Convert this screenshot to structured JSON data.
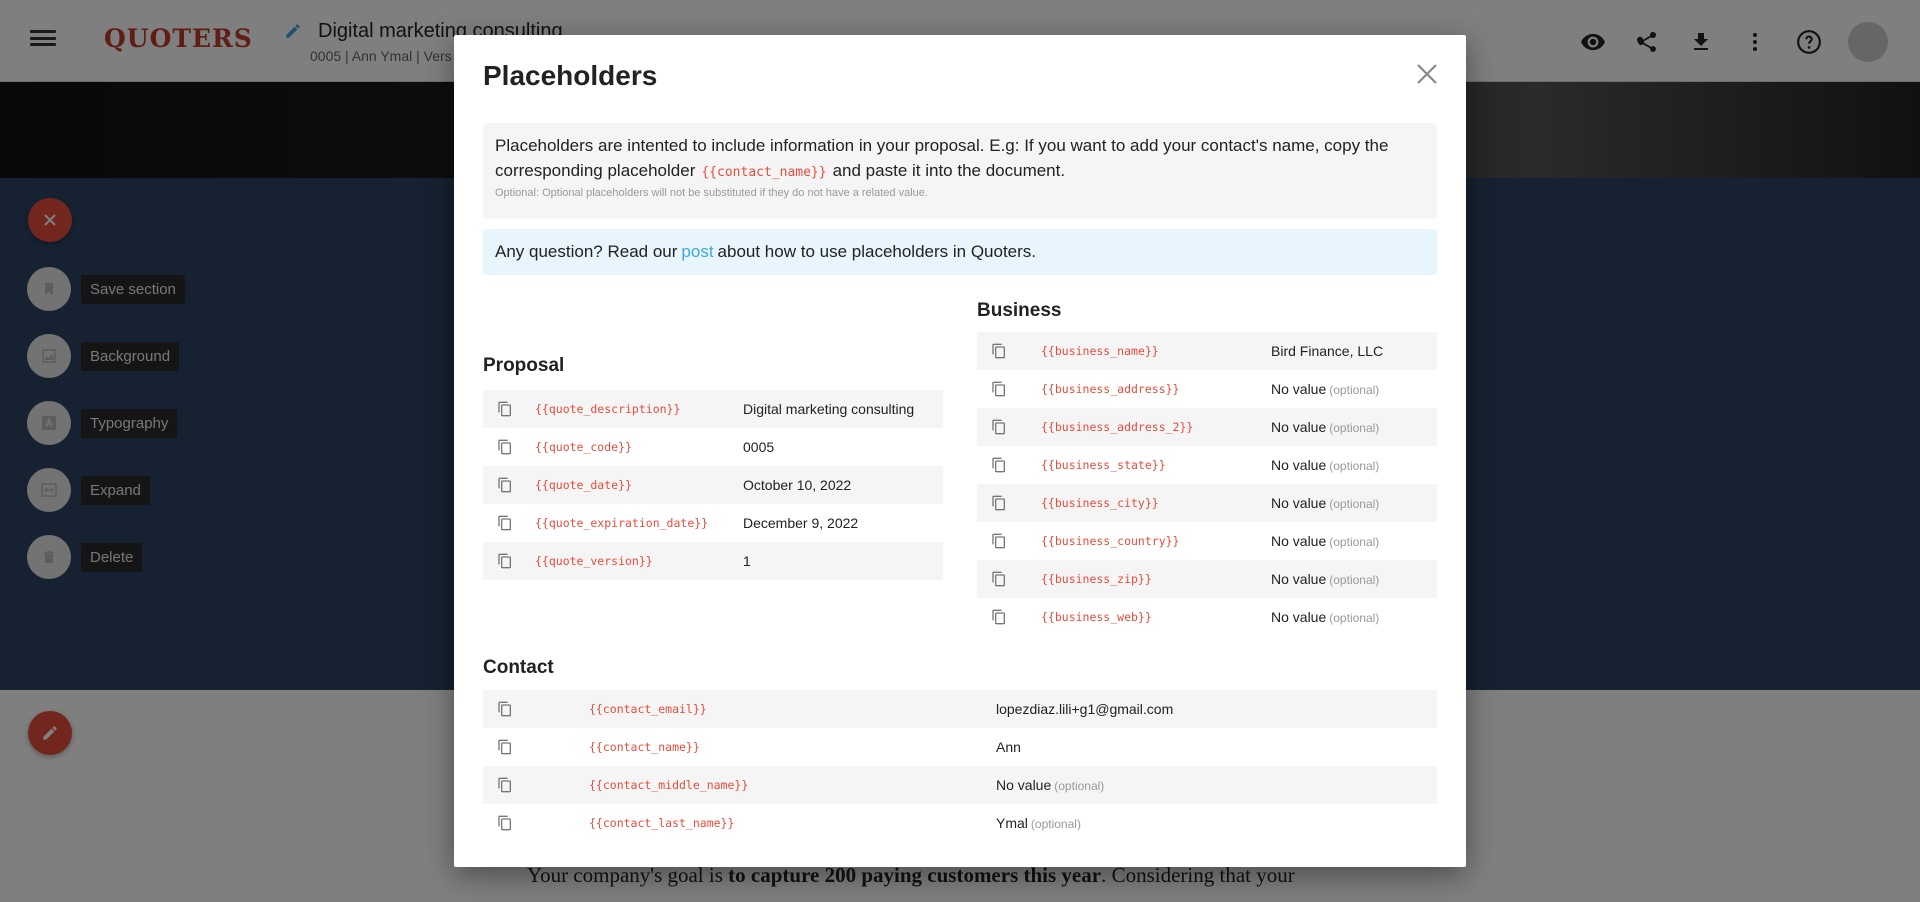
{
  "app": {
    "logo": "QUOTERS",
    "doc_title": "Digital marketing consulting",
    "doc_subtitle": "0005 | Ann Ymal | Vers"
  },
  "toolbar": {
    "icons": [
      "eye-icon",
      "share-icon",
      "download-icon",
      "more-vert-icon",
      "help-icon",
      "user-avatar"
    ]
  },
  "side_tools": [
    {
      "label": "Save section",
      "icon": "bookmark-icon"
    },
    {
      "label": "Background",
      "icon": "image-icon"
    },
    {
      "label": "Typography",
      "icon": "font-icon"
    },
    {
      "label": "Expand",
      "icon": "expand-icon"
    },
    {
      "label": "Delete",
      "icon": "trash-icon"
    }
  ],
  "body_text": {
    "before": "Your company's goal is ",
    "bold": "to capture 200 paying customers this year",
    "after": ". Considering that your"
  },
  "modal": {
    "title": "Placeholders",
    "info_text_1": "Placeholders are intented to include information in your proposal. E.g: If you want to add your contact's name, copy the corresponding placeholder",
    "info_code": "{{contact_name}}",
    "info_text_2": "and paste it into the document.",
    "info_optional": "Optional: Optional placeholders will not be substituted if they do not have a related value.",
    "question_before": "Any question? Read our",
    "question_link": "post",
    "question_after": "about how to use placeholders in Quoters.",
    "no_value": "No value",
    "optional_tag": "(optional)",
    "proposal": {
      "heading": "Proposal",
      "rows": [
        {
          "code": "{{quote_description}}",
          "value": "Digital marketing consulting",
          "optional": false
        },
        {
          "code": "{{quote_code}}",
          "value": "0005",
          "optional": false
        },
        {
          "code": "{{quote_date}}",
          "value": "October 10, 2022",
          "optional": false
        },
        {
          "code": "{{quote_expiration_date}}",
          "value": "December 9, 2022",
          "optional": false
        },
        {
          "code": "{{quote_version}}",
          "value": "1",
          "optional": false
        }
      ]
    },
    "business": {
      "heading": "Business",
      "rows": [
        {
          "code": "{{business_name}}",
          "value": "Bird Finance, LLC",
          "optional": false
        },
        {
          "code": "{{business_address}}",
          "value": "No value",
          "optional": true
        },
        {
          "code": "{{business_address_2}}",
          "value": "No value",
          "optional": true
        },
        {
          "code": "{{business_state}}",
          "value": "No value",
          "optional": true
        },
        {
          "code": "{{business_city}}",
          "value": "No value",
          "optional": true
        },
        {
          "code": "{{business_country}}",
          "value": "No value",
          "optional": true
        },
        {
          "code": "{{business_zip}}",
          "value": "No value",
          "optional": true
        },
        {
          "code": "{{business_web}}",
          "value": "No value",
          "optional": true
        }
      ]
    },
    "contact": {
      "heading": "Contact",
      "rows": [
        {
          "code": "{{contact_email}}",
          "value": "lopezdiaz.lili+g1@gmail.com",
          "optional": false
        },
        {
          "code": "{{contact_name}}",
          "value": "Ann",
          "optional": false
        },
        {
          "code": "{{contact_middle_name}}",
          "value": "No value",
          "optional": true
        },
        {
          "code": "{{contact_last_name}}",
          "value": "Ymal",
          "optional": true
        }
      ]
    }
  },
  "colors": {
    "brand": "#c0392b",
    "accent_red": "#e74c3c",
    "link": "#3fa9dc",
    "section_dark": "#2c4563"
  }
}
